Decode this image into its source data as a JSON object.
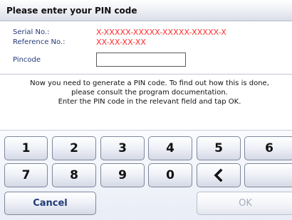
{
  "dialog": {
    "title": "Please enter your PIN code"
  },
  "fields": {
    "serial_label": "Serial No.:",
    "serial_value": "X-XXXXX-XXXXX-XXXXX-XXXXX-X",
    "reference_label": "Reference No.:",
    "reference_value": "XX-XX-XX-XX",
    "pincode_label": "Pincode",
    "pincode_value": ""
  },
  "instructions": [
    "Now you need to generate a PIN code. To find out how this is done,",
    "please consult the program documentation.",
    "Enter the PIN code in the relevant field and tap OK."
  ],
  "keypad": {
    "row1": [
      "1",
      "2",
      "3",
      "4",
      "5",
      "6"
    ],
    "row2": [
      "7",
      "8",
      "9",
      "0"
    ],
    "backspace_icon": "chevron-left-icon",
    "cancel_label": "Cancel",
    "ok_label": "OK"
  },
  "colors": {
    "value_text": "#ff2d2d",
    "label_text": "#243a7a",
    "disabled_text": "#a7adbb"
  }
}
